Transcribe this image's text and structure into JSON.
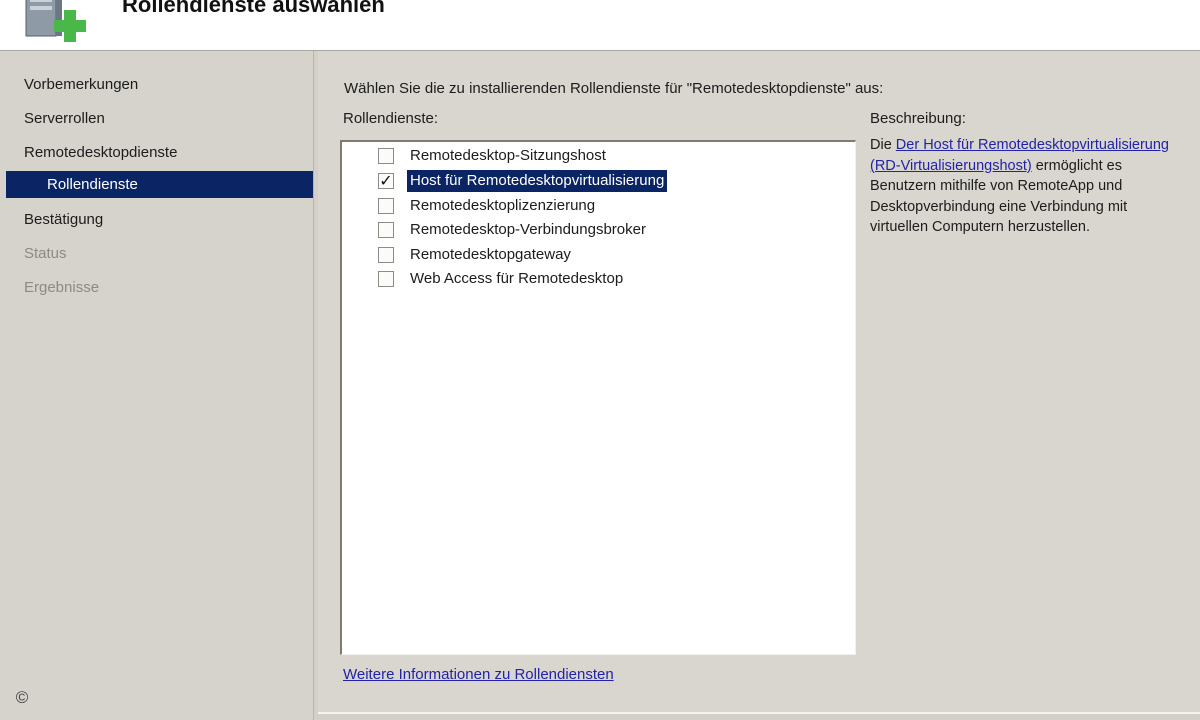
{
  "header": {
    "title": "Rollendienste auswählen",
    "icon": "server-add-icon"
  },
  "sidebar": {
    "items": [
      {
        "label": "Vorbemerkungen",
        "state": "normal"
      },
      {
        "label": "Serverrollen",
        "state": "normal"
      },
      {
        "label": "Remotedesktopdienste",
        "state": "normal"
      },
      {
        "label": "Rollendienste",
        "state": "active"
      },
      {
        "label": "Bestätigung",
        "state": "normal"
      },
      {
        "label": "Status",
        "state": "disabled"
      },
      {
        "label": "Ergebnisse",
        "state": "disabled"
      }
    ]
  },
  "main": {
    "prompt": "Wählen Sie die zu installierenden Rollendienste für \"Remotedesktopdienste\" aus:",
    "list_label": "Rollendienste:",
    "services": [
      {
        "label": "Remotedesktop-Sitzungshost",
        "checked": false
      },
      {
        "label": "Host für Remotedesktopvirtualisierung",
        "checked": true
      },
      {
        "label": "Remotedesktoplizenzierung",
        "checked": false
      },
      {
        "label": "Remotedesktop-Verbindungsbroker",
        "checked": false
      },
      {
        "label": "Remotedesktopgateway",
        "checked": false
      },
      {
        "label": "Web Access für Remotedesktop",
        "checked": false
      }
    ],
    "more_info_link": "Weitere Informationen zu Rollendiensten"
  },
  "description": {
    "label": "Beschreibung:",
    "prefix": "Die ",
    "link": "Der Host für Remotedesktopvirtualisierung (RD-Virtualisierungshost)",
    "suffix": " ermöglicht es Benutzern mithilfe von RemoteApp und Desktopverbindung eine Verbindung mit virtuellen Computern herzustellen."
  },
  "footer": {
    "copyright": "©"
  },
  "colors": {
    "selection": "#0b2463",
    "link": "#2323a8",
    "background": "#d4d0c8"
  }
}
